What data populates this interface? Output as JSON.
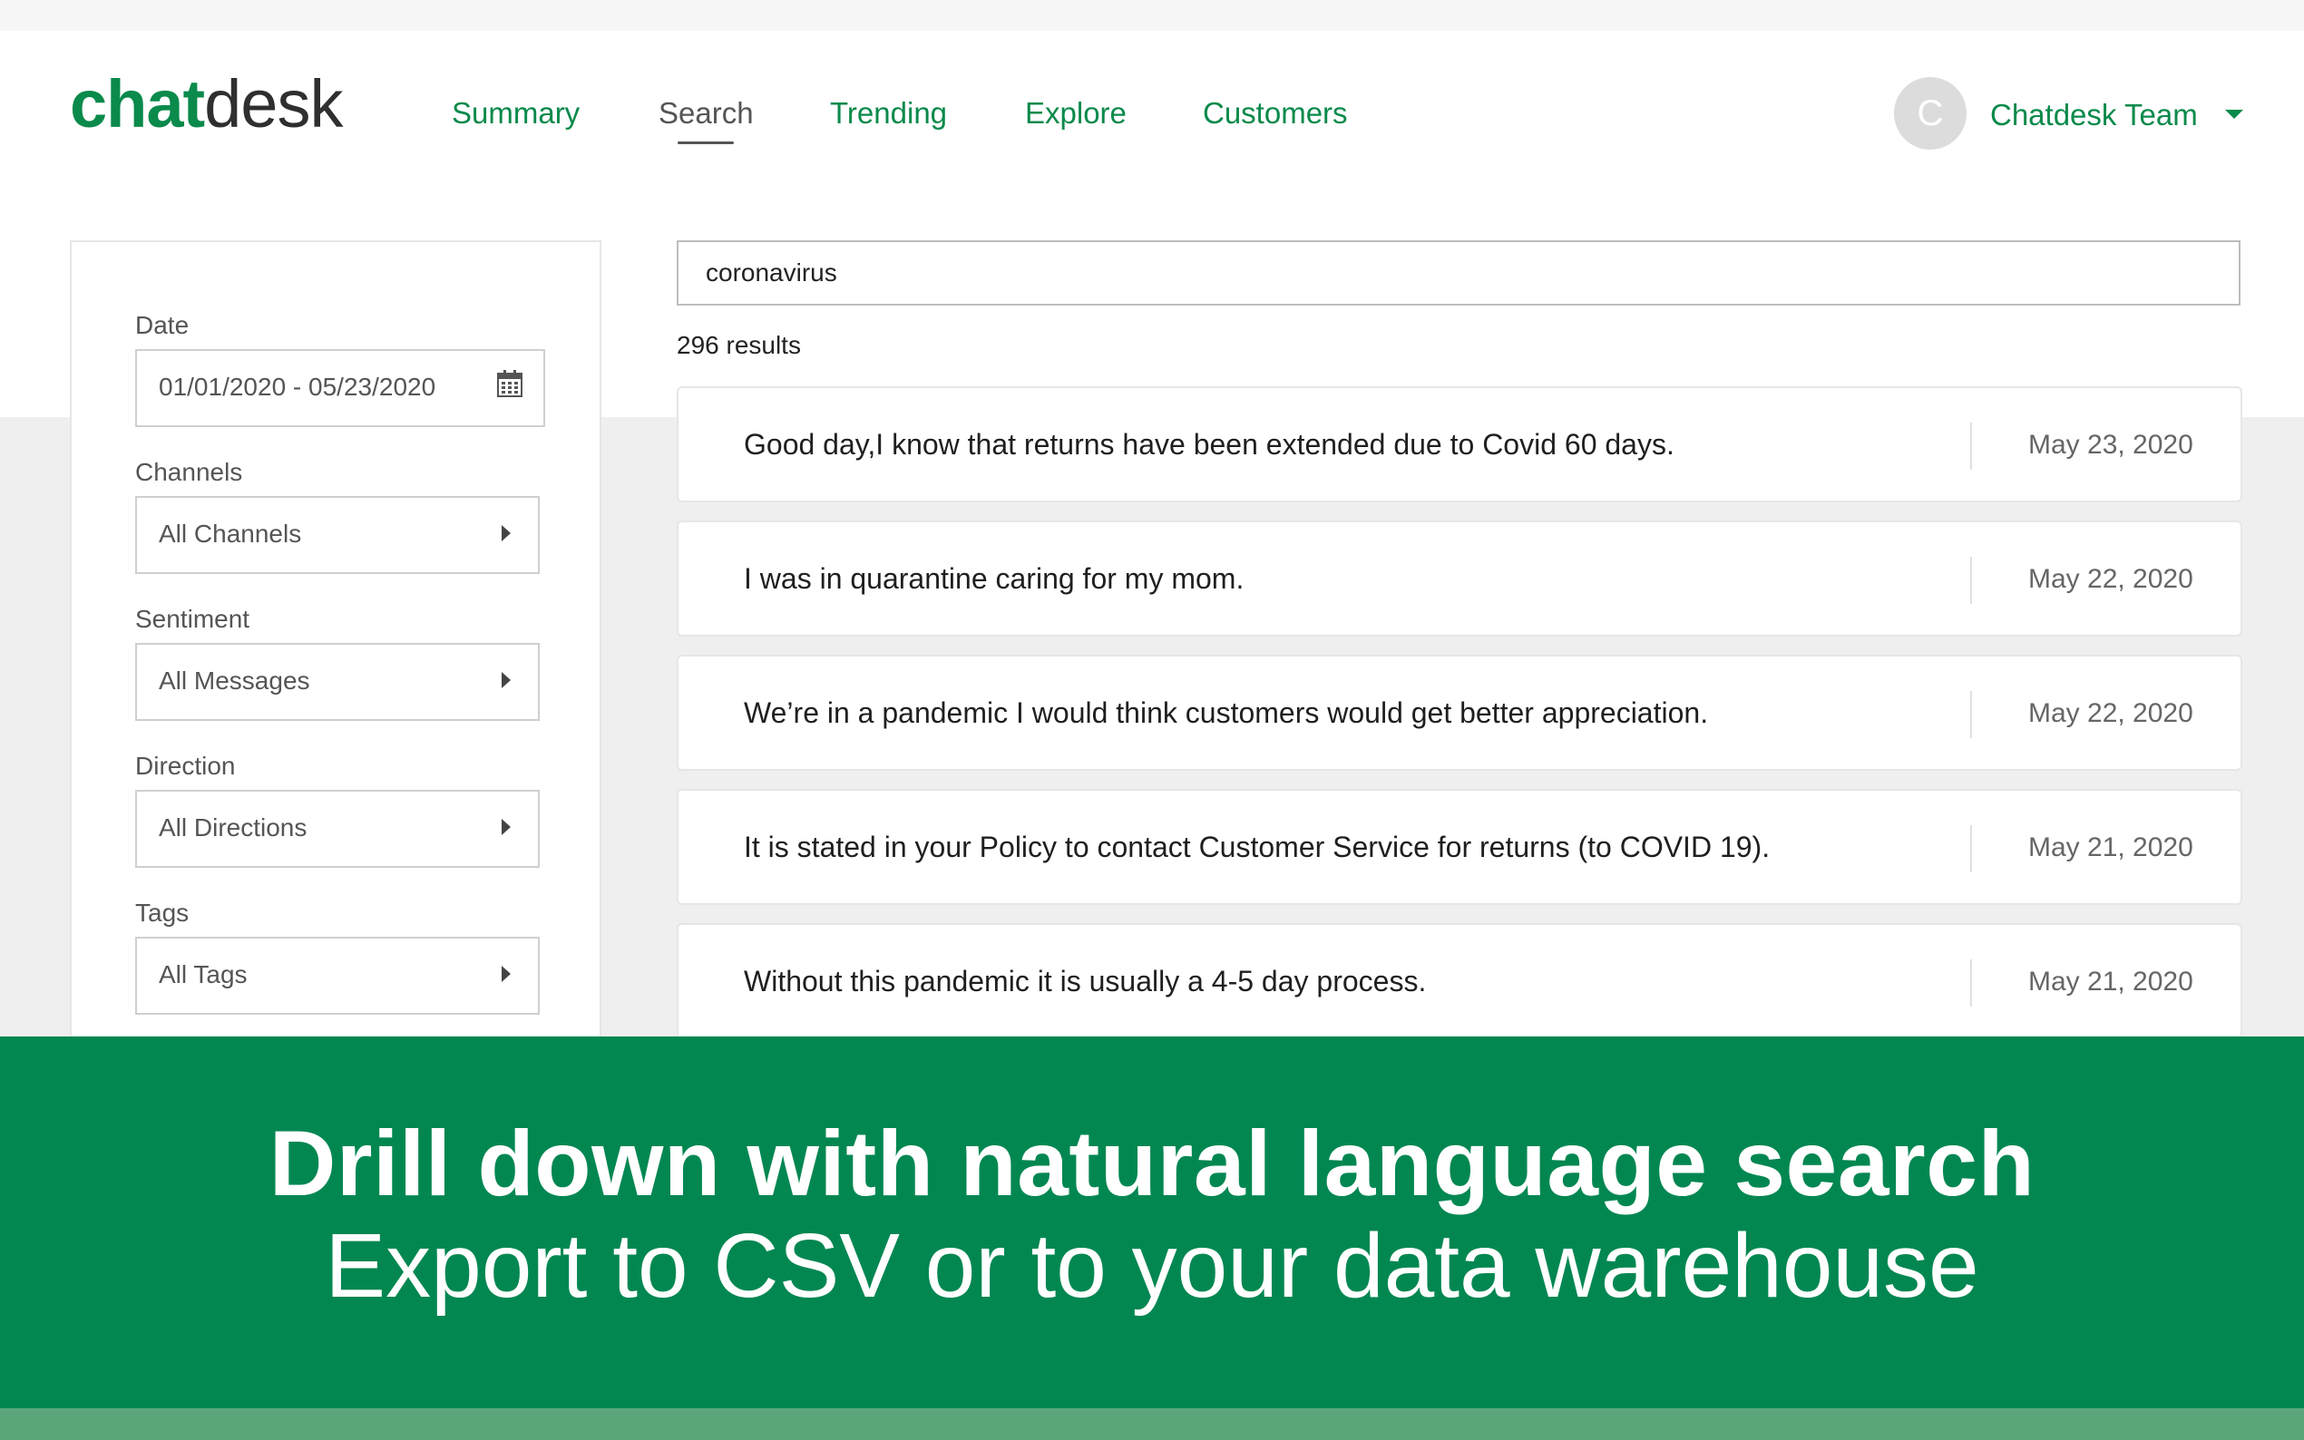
{
  "logo": {
    "part1": "chat",
    "part2": "desk"
  },
  "nav": {
    "items": [
      {
        "label": "Summary"
      },
      {
        "label": "Search"
      },
      {
        "label": "Trending"
      },
      {
        "label": "Explore"
      },
      {
        "label": "Customers"
      }
    ],
    "active": "Search"
  },
  "user": {
    "initial": "C",
    "name": "Chatdesk Team"
  },
  "filters": {
    "date": {
      "label": "Date",
      "value": "01/01/2020 - 05/23/2020"
    },
    "channels": {
      "label": "Channels",
      "value": "All Channels"
    },
    "sentiment": {
      "label": "Sentiment",
      "value": "All Messages"
    },
    "direction": {
      "label": "Direction",
      "value": "All Directions"
    },
    "tags": {
      "label": "Tags",
      "value": "All Tags"
    }
  },
  "search": {
    "value": "coronavirus",
    "results_count": "296 results"
  },
  "results": [
    {
      "message": "Good day,I know that returns have been extended due to Covid 60 days.",
      "date": "May 23, 2020"
    },
    {
      "message": "I was in quarantine caring for my mom.",
      "date": "May 22, 2020"
    },
    {
      "message": "We’re in a pandemic I would think customers would get better appreciation.",
      "date": "May 22, 2020"
    },
    {
      "message": "It is stated in your Policy to contact Customer Service for returns (to COVID 19).",
      "date": "May 21, 2020"
    },
    {
      "message": "Without this pandemic it is usually a 4-5 day process.",
      "date": "May 21, 2020"
    }
  ],
  "banner": {
    "title": "Drill down with natural language search",
    "subtitle": "Export to CSV or to your data warehouse"
  },
  "colors": {
    "brand_green": "#0a8a4b",
    "banner_green": "#028751"
  },
  "icons": {
    "calendar": "calendar-icon",
    "dropdown": "caret-down-icon",
    "expand": "caret-right-icon"
  }
}
